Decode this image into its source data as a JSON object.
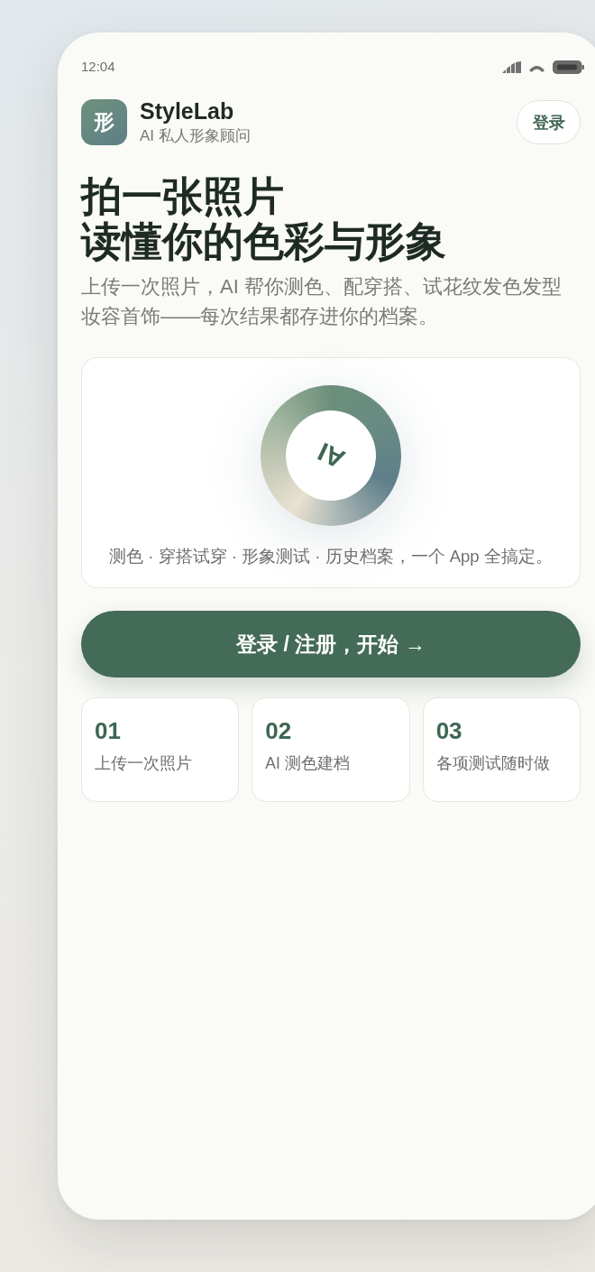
{
  "status_bar": {
    "time": "12:04"
  },
  "header": {
    "logo": "形",
    "title": "StyleLab",
    "subtitle": "AI 私人形象顾问",
    "login_button": "登录"
  },
  "hero": {
    "title_lines": [
      "拍一张照片",
      "读懂你的色彩与形象"
    ],
    "description": "上传一次照片，AI 帮你测色、配穿搭、试花纹发色发型妆容首饰——每次结果都存进你的档案。"
  },
  "feature_card": {
    "ring_label": "AI",
    "caption": "测色 · 穿搭试穿 · 形象测试 · 历史档案，一个 App 全搞定。"
  },
  "cta_button": "登录 / 注册，开始 →",
  "steps": [
    {
      "number": "01",
      "label": "上传一次照片"
    },
    {
      "number": "02",
      "label": "AI 测色建档"
    },
    {
      "number": "03",
      "label": "各项测试随时做"
    }
  ]
}
